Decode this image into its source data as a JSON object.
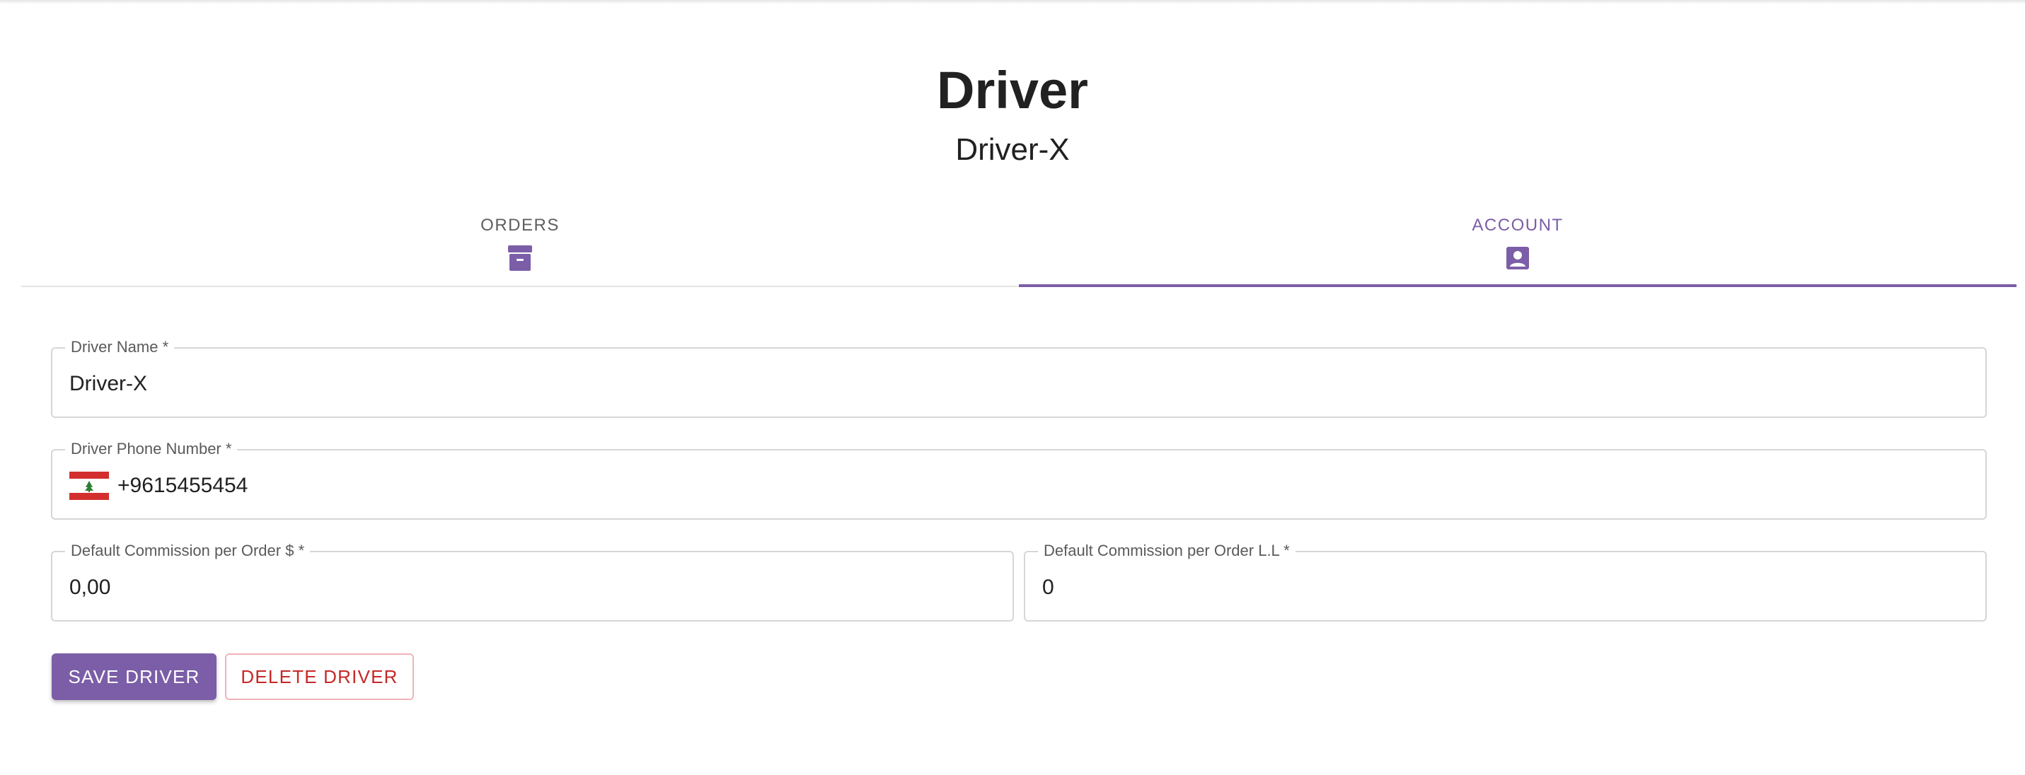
{
  "header": {
    "title": "Driver",
    "subtitle": "Driver-X"
  },
  "tabs": [
    {
      "label": "ORDERS",
      "icon": "archive-icon",
      "active": false
    },
    {
      "label": "ACCOUNT",
      "icon": "account-box-icon",
      "active": true
    }
  ],
  "form": {
    "driver_name": {
      "label": "Driver Name",
      "required_mark": "*",
      "value": "Driver-X"
    },
    "driver_phone": {
      "label": "Driver Phone Number",
      "required_mark": "*",
      "value": "+9615455454",
      "country_flag": "lebanon-flag-icon"
    },
    "commission_usd": {
      "label": "Default Commission per Order $",
      "required_mark": "*",
      "value": "0,00"
    },
    "commission_ll": {
      "label": "Default Commission per Order L.L",
      "required_mark": "*",
      "value": "0"
    }
  },
  "actions": {
    "save_label": "SAVE DRIVER",
    "delete_label": "DELETE DRIVER"
  },
  "colors": {
    "primary": "#7b5ea7",
    "danger": "#c62828",
    "border": "#d6d6d6"
  }
}
